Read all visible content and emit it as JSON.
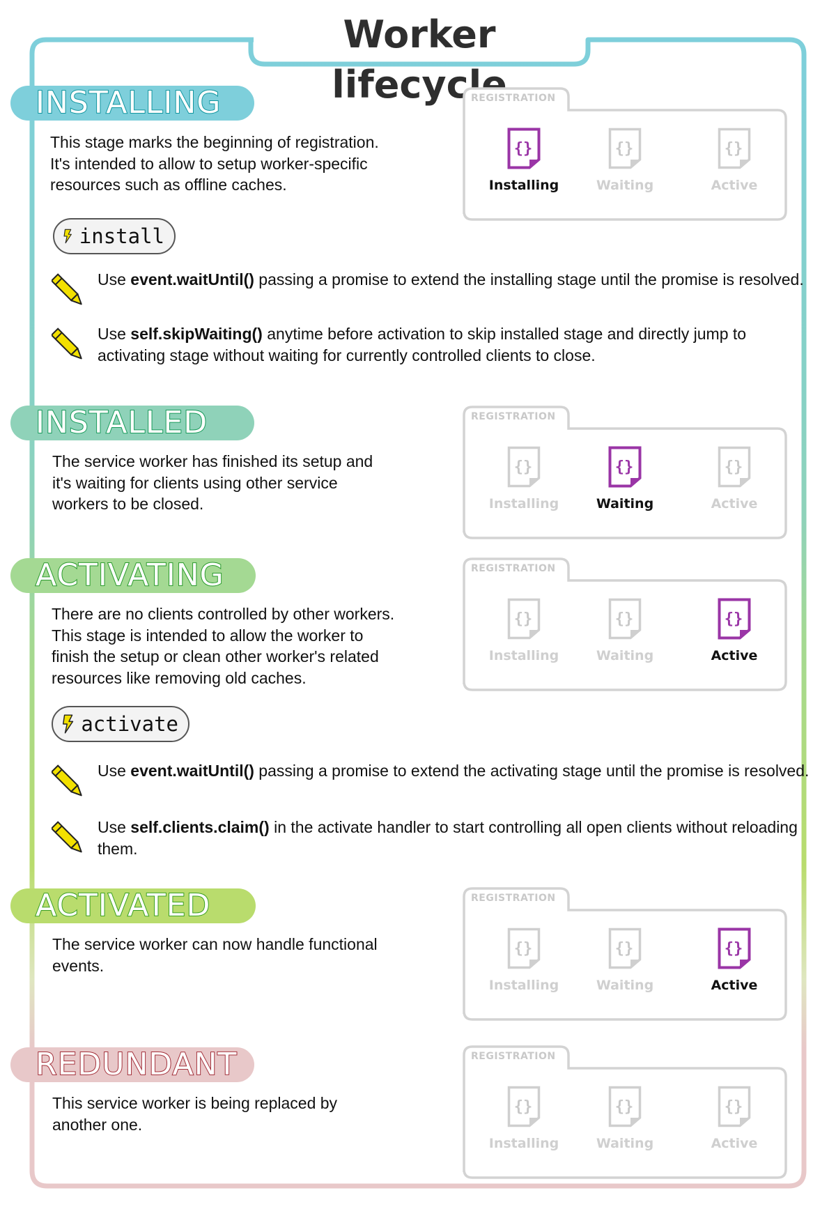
{
  "title": "Worker lifecycle",
  "colors": {
    "frame_top": "#7ecfdb",
    "frame_mid": "#8fd2b9",
    "frame_green": "#b9dc6d",
    "frame_bottom": "#e8c8c9",
    "active_icon": "#9a35a6",
    "inactive": "#cfcfcf",
    "pencil": "#f2e000",
    "bolt": "#f2e000"
  },
  "registration_label": "REGISTRATION",
  "slot_labels": [
    "Installing",
    "Waiting",
    "Active"
  ],
  "sections": [
    {
      "id": "installing",
      "heading": "INSTALLING",
      "description": [
        "This stage marks the beginning of registration.",
        "It's intended to allow to setup worker-specific",
        "resources such as offline caches."
      ],
      "active_slot": 0,
      "event": "install",
      "tips": [
        {
          "pre": "Use ",
          "code": "event.waitUntil()",
          "post": " passing a promise to extend the installing stage until the promise is resolved."
        },
        {
          "pre": "Use ",
          "code": "self.skipWaiting()",
          "post": " anytime before activation to skip installed stage and directly jump to activating stage without waiting for currently controlled clients to close."
        }
      ]
    },
    {
      "id": "installed",
      "heading": "INSTALLED",
      "description": [
        "The service worker has finished its setup and",
        "it's waiting for clients using other service",
        "workers to be closed."
      ],
      "active_slot": 1
    },
    {
      "id": "activating",
      "heading": "ACTIVATING",
      "description": [
        "There are no clients controlled by other workers.",
        "This stage is intended to allow the worker to",
        "finish the setup or clean other worker's related",
        "resources like removing old caches."
      ],
      "active_slot": 2,
      "event": "activate",
      "tips": [
        {
          "pre": "Use ",
          "code": "event.waitUntil()",
          "post": " passing a promise to extend the activating stage until the promise is resolved."
        },
        {
          "pre": "Use ",
          "code": "self.clients.claim()",
          "post": "  in the activate handler to start controlling all open clients without reloading them."
        }
      ]
    },
    {
      "id": "activated",
      "heading": "ACTIVATED",
      "description": [
        "The service worker can now handle functional",
        "events."
      ],
      "active_slot": 2
    },
    {
      "id": "redundant",
      "heading": "REDUNDANT",
      "description": [
        "This service worker is being replaced by",
        "another one."
      ],
      "active_slot": null
    }
  ]
}
